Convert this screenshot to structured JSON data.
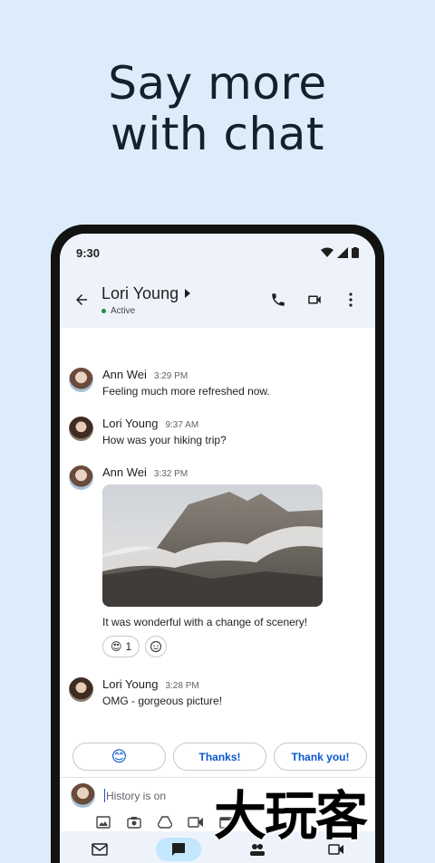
{
  "headline": {
    "line1": "Say more",
    "line2": "with chat"
  },
  "status_bar": {
    "time": "9:30",
    "icons": [
      "wifi-icon",
      "signal-icon",
      "battery-icon"
    ]
  },
  "app_bar": {
    "contact_name": "Lori Young",
    "contact_status": "Active",
    "status_color": "#1e8e3e",
    "actions": [
      "phone-icon",
      "video-icon",
      "more-vert-icon"
    ]
  },
  "messages": [
    {
      "sender": "Ann Wei",
      "time": "3:29 PM",
      "text": "Feeling much more refreshed now."
    },
    {
      "sender": "Lori Young",
      "time": "9:37 AM",
      "text": "How was your hiking trip?"
    },
    {
      "sender": "Ann Wei",
      "time": "3:32 PM",
      "text": "It was wonderful with a change of scenery!",
      "reaction_emoji": "😍",
      "reaction_count": "1"
    },
    {
      "sender": "Lori Young",
      "time": "3:28 PM",
      "text": "OMG - gorgeous picture!"
    }
  ],
  "smart_replies": [
    "😊",
    "Thanks!",
    "Thank you!"
  ],
  "compose": {
    "placeholder": "History is on"
  },
  "toolbar": [
    "image-icon",
    "camera-icon",
    "drive-icon",
    "video-icon",
    "calendar-icon"
  ],
  "nav": [
    "mail-icon",
    "chat-icon",
    "spaces-icon",
    "meet-icon"
  ],
  "watermark": "大玩客",
  "accent_color": "#0b57d0"
}
